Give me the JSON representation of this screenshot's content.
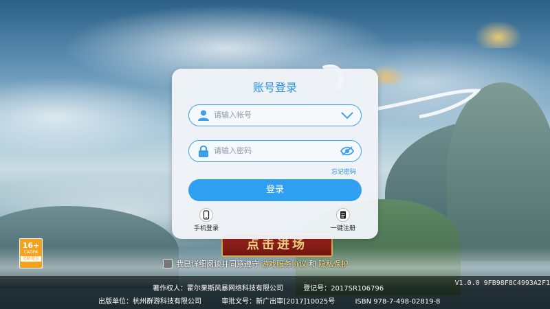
{
  "login_dialog": {
    "title": "账号登录",
    "account_placeholder": "请输入帐号",
    "password_placeholder": "请输入密码",
    "forgot_password": "忘记密码",
    "login_button": "登录",
    "phone_login": "手机登录",
    "one_click_register": "一键注册"
  },
  "enter_game_button": "点击进场",
  "age_rating": {
    "age": "16+",
    "org": "CADPA",
    "label": "适龄提示"
  },
  "agreement": {
    "prefix": "我已详细阅读并同意遵守",
    "service_agreement": "游戏服务协议",
    "and": "和",
    "privacy": "隐私保护"
  },
  "footer": {
    "copyright": "著作权人：霍尔果斯风暴网络科技有限公司",
    "registration": "登记号：2017SR106796",
    "publisher": "出版单位：杭州群游科技有限公司",
    "approval": "审批文号：新广出审[2017]10025号",
    "isbn": "ISBN 978-7-498-02819-8"
  },
  "version": "V1.0.0 9FB98F8C4993A2F1",
  "colors": {
    "accent": "#2f9ff2",
    "title": "#2b8ee6",
    "age_badge": "#f6a11c",
    "agreement_link": "#f8e38a"
  },
  "icons": [
    "user-icon",
    "chevron-down-icon",
    "lock-icon",
    "eye-icon",
    "phone-icon",
    "register-icon"
  ]
}
